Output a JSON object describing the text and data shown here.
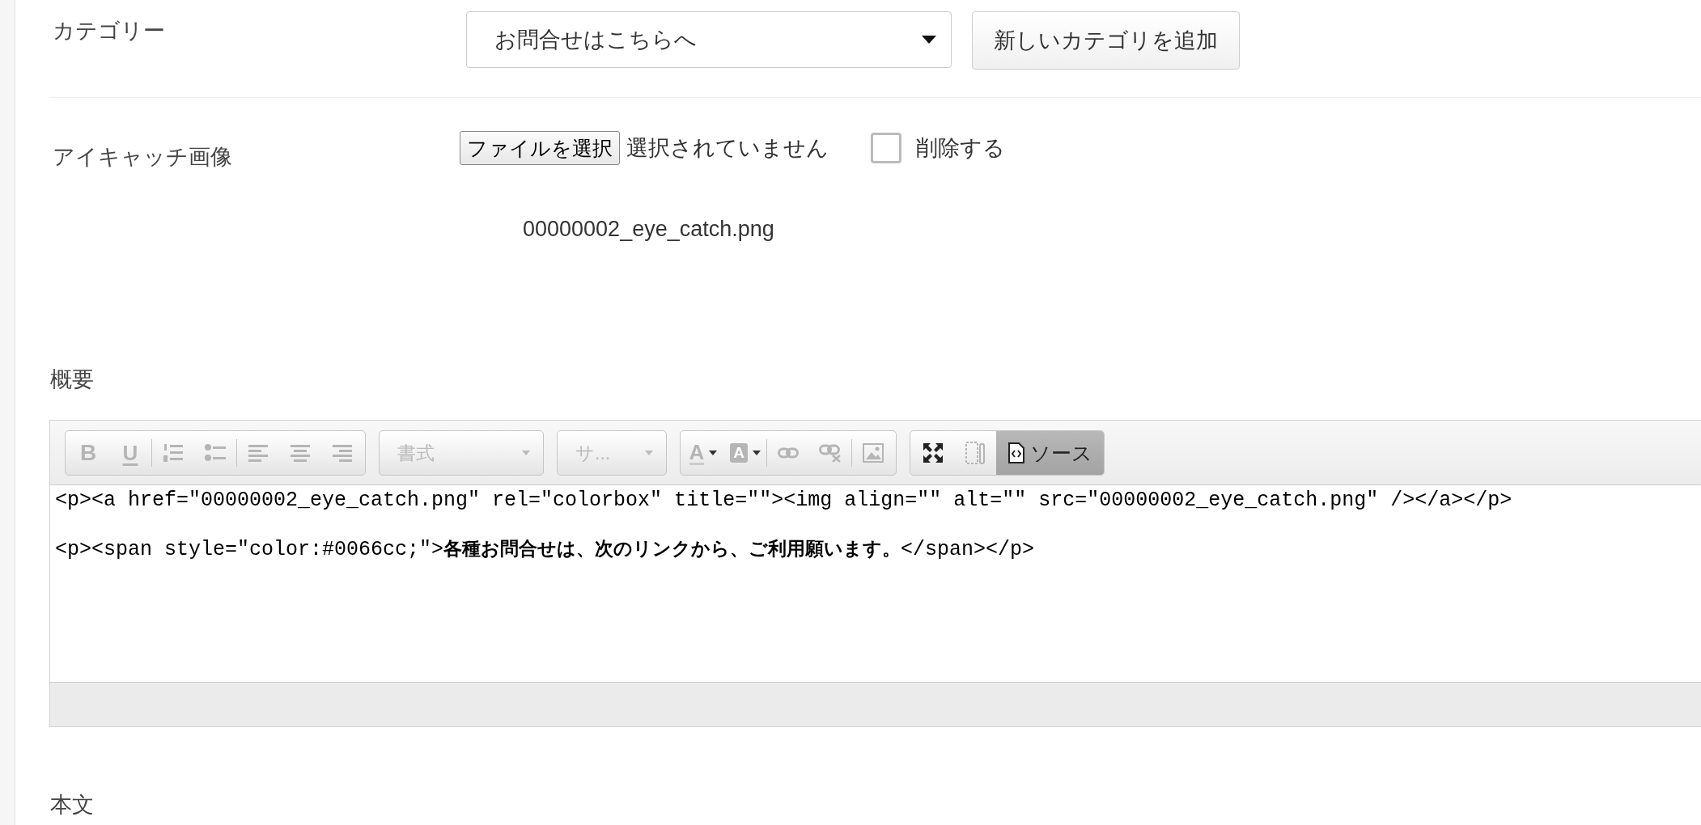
{
  "category": {
    "label": "カテゴリー",
    "value": "お問合せはこちらへ",
    "add_button": "新しいカテゴリを追加"
  },
  "eye_catch": {
    "label": "アイキャッチ画像",
    "file_button": "ファイルを選択",
    "file_status": "選択されていません",
    "delete_label": "削除する",
    "delete_checked": false,
    "filename": "00000002_eye_catch.png"
  },
  "summary": {
    "label": "概要",
    "toolbar": [
      [
        {
          "kind": "bold",
          "label": "B",
          "disabled": true
        },
        {
          "kind": "underline",
          "label": "U",
          "disabled": true
        },
        {
          "kind": "separator"
        },
        {
          "kind": "ordered-list",
          "disabled": true
        },
        {
          "kind": "bullet-list",
          "disabled": true
        },
        {
          "kind": "separator"
        },
        {
          "kind": "align-left",
          "disabled": true
        },
        {
          "kind": "align-center",
          "disabled": true
        },
        {
          "kind": "align-right",
          "disabled": true
        }
      ],
      [
        {
          "kind": "combo",
          "label": "書式",
          "disabled": true
        }
      ],
      [
        {
          "kind": "combo",
          "label": "サ...",
          "disabled": true
        }
      ],
      [
        {
          "kind": "text-color",
          "label": "A",
          "disabled": true
        },
        {
          "kind": "background-color",
          "label": "A",
          "disabled": true
        },
        {
          "kind": "separator"
        },
        {
          "kind": "link",
          "disabled": true
        },
        {
          "kind": "unlink",
          "disabled": true
        },
        {
          "kind": "separator"
        },
        {
          "kind": "image",
          "disabled": true
        }
      ],
      [
        {
          "kind": "maximize",
          "disabled": false
        },
        {
          "kind": "show-blocks",
          "disabled": true
        },
        {
          "kind": "source",
          "label": "ソース",
          "disabled": false,
          "on": true
        }
      ]
    ],
    "source_lines": [
      "<p><a href=\"00000002_eye_catch.png\" rel=\"colorbox\" title=\"\"><img align=\"\" alt=\"\" src=\"00000002_eye_catch.png\" /></a></p>",
      "<p><span style=\"color:#0066cc;\">**各種お問合せは、次のリンクから、ご利用願います。**</span></p>"
    ]
  },
  "body": {
    "label": "本文"
  }
}
